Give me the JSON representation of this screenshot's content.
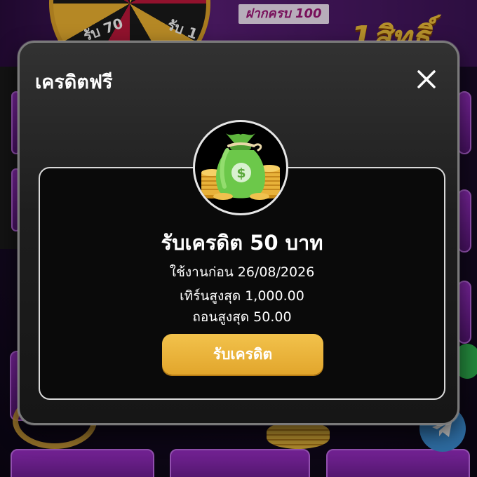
{
  "background": {
    "wheel_labels": [
      "รับ 70",
      "รับ 1"
    ],
    "promo_badge": "ฝากครบ 100",
    "promo_big": "1สิทธิ์"
  },
  "modal": {
    "title": "เครดิตฟรี",
    "close_icon": "close-icon",
    "card": {
      "image_icon": "money-bag-icon",
      "headline": "รับเครดิต 50 บาท",
      "expiry": "ใช้งานก่อน 26/08/2026",
      "turnover": "เทิร์นสูงสุด 1,000.00",
      "withdraw": "ถอนสูงสุด 50.00",
      "button_label": "รับเครดิต"
    }
  },
  "colors": {
    "accent_gold": "#e9b23a",
    "modal_bg": "#1e1e1e",
    "text": "#ffffff"
  }
}
